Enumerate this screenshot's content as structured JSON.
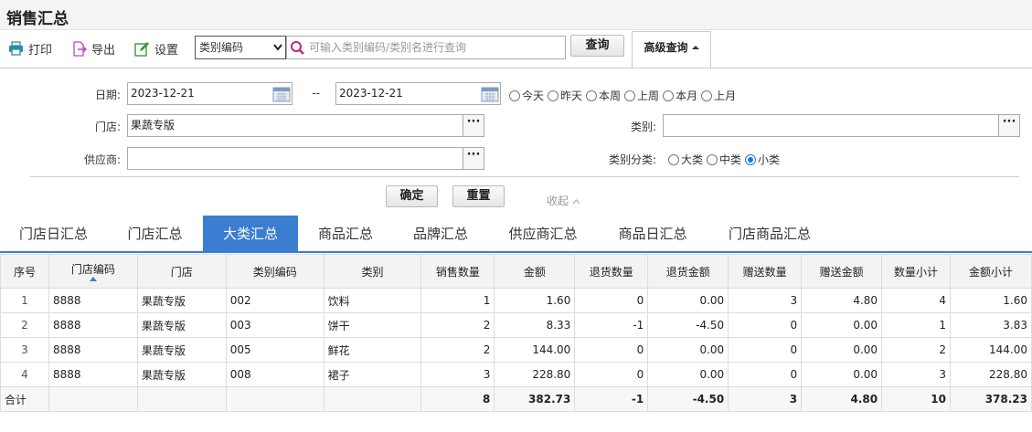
{
  "title": "销售汇总",
  "toolbar": {
    "print_label": "打印",
    "export_label": "导出",
    "settings_label": "设置",
    "search_field_selected": "类别编码",
    "search_placeholder": "可输入类别编码/类别名进行查询",
    "query_label": "查询",
    "advanced_label": "高级查询"
  },
  "filter": {
    "date_label": "日期:",
    "date_from": "2023-12-21",
    "date_sep": "--",
    "date_to": "2023-12-21",
    "quick_dates": [
      "今天",
      "昨天",
      "本周",
      "上周",
      "本月",
      "上月"
    ],
    "store_label": "门店:",
    "store_value": "果蔬专版",
    "category_label": "类别:",
    "category_value": "",
    "supplier_label": "供应商:",
    "supplier_value": "",
    "category_level_label": "类别分类:",
    "category_levels": [
      "大类",
      "中类",
      "小类"
    ],
    "category_level_selected": "小类",
    "confirm_label": "确定",
    "reset_label": "重置",
    "collapse_label": "收起"
  },
  "tabs": [
    {
      "label": "门店日汇总",
      "active": false
    },
    {
      "label": "门店汇总",
      "active": false
    },
    {
      "label": "大类汇总",
      "active": true
    },
    {
      "label": "商品汇总",
      "active": false
    },
    {
      "label": "品牌汇总",
      "active": false
    },
    {
      "label": "供应商汇总",
      "active": false
    },
    {
      "label": "商品日汇总",
      "active": false
    },
    {
      "label": "门店商品汇总",
      "active": false
    }
  ],
  "table": {
    "columns": [
      "序号",
      "门店编码",
      "门店",
      "类别编码",
      "类别",
      "销售数量",
      "金额",
      "退货数量",
      "退货金额",
      "赠送数量",
      "赠送金额",
      "数量小计",
      "金额小计"
    ],
    "rows": [
      [
        "1",
        "8888",
        "果蔬专版",
        "002",
        "饮料",
        "1",
        "1.60",
        "0",
        "0.00",
        "3",
        "4.80",
        "4",
        "1.60"
      ],
      [
        "2",
        "8888",
        "果蔬专版",
        "003",
        "饼干",
        "2",
        "8.33",
        "-1",
        "-4.50",
        "0",
        "0.00",
        "1",
        "3.83"
      ],
      [
        "3",
        "8888",
        "果蔬专版",
        "005",
        "鲜花",
        "2",
        "144.00",
        "0",
        "0.00",
        "0",
        "0.00",
        "2",
        "144.00"
      ],
      [
        "4",
        "8888",
        "果蔬专版",
        "008",
        "裙子",
        "3",
        "228.80",
        "0",
        "0.00",
        "0",
        "0.00",
        "3",
        "228.80"
      ]
    ],
    "total": [
      "合计",
      "",
      "",
      "",
      "",
      "8",
      "382.73",
      "-1",
      "-4.50",
      "3",
      "4.80",
      "10",
      "378.23"
    ]
  },
  "colors": {
    "accent": "#3b7dd0",
    "radio_selected": "#1a73e8"
  }
}
